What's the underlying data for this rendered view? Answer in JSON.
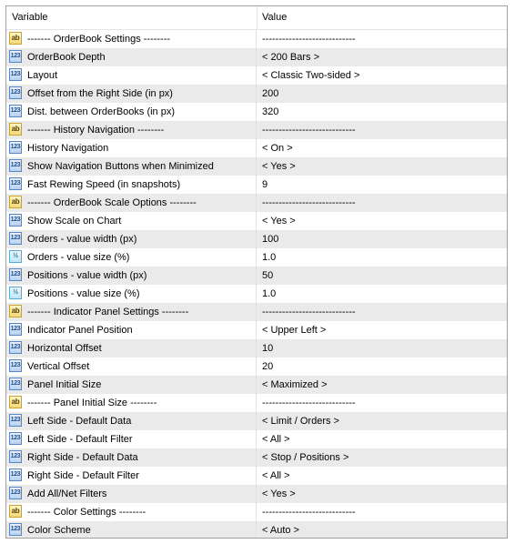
{
  "header": {
    "variable": "Variable",
    "value": "Value"
  },
  "rows": [
    {
      "type": "str",
      "icon_text": "ab",
      "name": "------- OrderBook Settings --------",
      "value": "----------------------------"
    },
    {
      "type": "num",
      "icon_text": "123",
      "name": "OrderBook Depth",
      "value": "< 200 Bars >"
    },
    {
      "type": "num",
      "icon_text": "123",
      "name": "Layout",
      "value": "< Classic Two-sided >"
    },
    {
      "type": "num",
      "icon_text": "123",
      "name": "Offset from the Right Side (in px)",
      "value": "200"
    },
    {
      "type": "num",
      "icon_text": "123",
      "name": "Dist. between OrderBooks (in px)",
      "value": "320"
    },
    {
      "type": "str",
      "icon_text": "ab",
      "name": "------- History Navigation --------",
      "value": "----------------------------"
    },
    {
      "type": "num",
      "icon_text": "123",
      "name": "History Navigation",
      "value": "< On >"
    },
    {
      "type": "num",
      "icon_text": "123",
      "name": "Show Navigation Buttons when Minimized",
      "value": "< Yes >"
    },
    {
      "type": "num",
      "icon_text": "123",
      "name": "Fast Rewing Speed (in snapshots)",
      "value": "9"
    },
    {
      "type": "str",
      "icon_text": "ab",
      "name": "------- OrderBook Scale Options --------",
      "value": "----------------------------"
    },
    {
      "type": "num",
      "icon_text": "123",
      "name": "Show Scale on Chart",
      "value": "< Yes >"
    },
    {
      "type": "num",
      "icon_text": "123",
      "name": "Orders - value width (px)",
      "value": "100"
    },
    {
      "type": "dbl",
      "icon_text": "½",
      "name": "Orders - value size (%)",
      "value": "1.0"
    },
    {
      "type": "num",
      "icon_text": "123",
      "name": "Positions - value width (px)",
      "value": "50"
    },
    {
      "type": "dbl",
      "icon_text": "½",
      "name": "Positions - value size (%)",
      "value": "1.0"
    },
    {
      "type": "str",
      "icon_text": "ab",
      "name": "------- Indicator Panel Settings --------",
      "value": "----------------------------"
    },
    {
      "type": "num",
      "icon_text": "123",
      "name": "Indicator Panel Position",
      "value": "< Upper Left >"
    },
    {
      "type": "num",
      "icon_text": "123",
      "name": "Horizontal Offset",
      "value": "10"
    },
    {
      "type": "num",
      "icon_text": "123",
      "name": "Vertical Offset",
      "value": "20"
    },
    {
      "type": "num",
      "icon_text": "123",
      "name": "Panel Initial Size",
      "value": "< Maximized >"
    },
    {
      "type": "str",
      "icon_text": "ab",
      "name": "------- Panel Initial Size --------",
      "value": "----------------------------"
    },
    {
      "type": "num",
      "icon_text": "123",
      "name": "Left Side - Default Data",
      "value": "< Limit / Orders >"
    },
    {
      "type": "num",
      "icon_text": "123",
      "name": "Left Side - Default Filter",
      "value": "< All >"
    },
    {
      "type": "num",
      "icon_text": "123",
      "name": "Right Side - Default Data",
      "value": "< Stop / Positions >"
    },
    {
      "type": "num",
      "icon_text": "123",
      "name": "Right Side - Default Filter",
      "value": "< All >"
    },
    {
      "type": "num",
      "icon_text": "123",
      "name": "Add All/Net Filters",
      "value": "< Yes >"
    },
    {
      "type": "str",
      "icon_text": "ab",
      "name": "------- Color Settings --------",
      "value": "----------------------------"
    },
    {
      "type": "num",
      "icon_text": "123",
      "name": "Color Scheme",
      "value": "< Auto >"
    }
  ]
}
